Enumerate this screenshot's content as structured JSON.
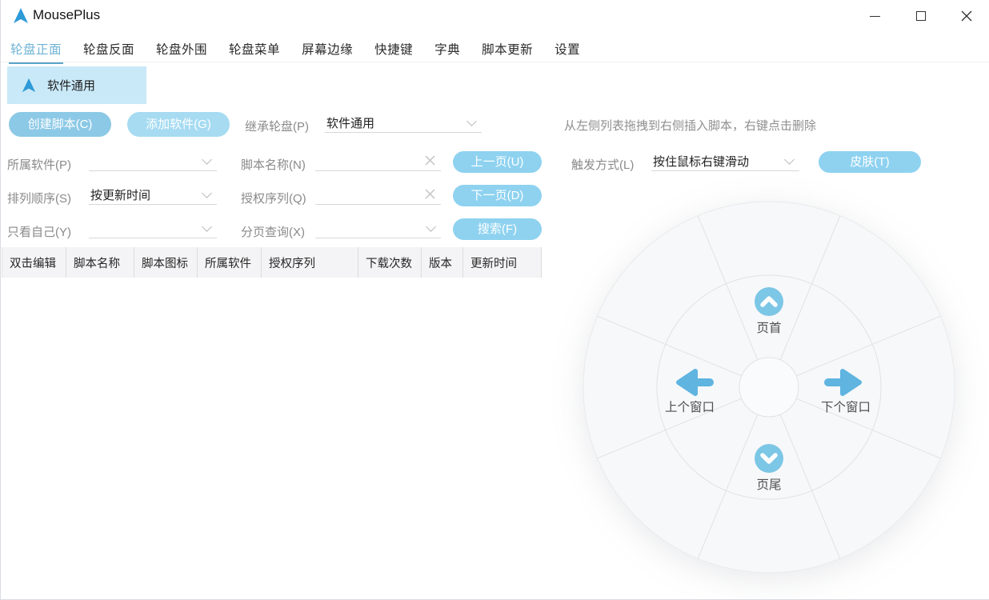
{
  "window": {
    "title": "MousePlus",
    "controls": [
      "minimize",
      "maximize",
      "close"
    ]
  },
  "tabs": [
    {
      "label": "轮盘正面",
      "active": true
    },
    {
      "label": "轮盘反面",
      "active": false
    },
    {
      "label": "轮盘外围",
      "active": false
    },
    {
      "label": "轮盘菜单",
      "active": false
    },
    {
      "label": "屏幕边缘",
      "active": false
    },
    {
      "label": "快捷键",
      "active": false
    },
    {
      "label": "字典",
      "active": false
    },
    {
      "label": "脚本更新",
      "active": false
    },
    {
      "label": "设置",
      "active": false
    }
  ],
  "selected_wheel": {
    "label": "软件通用"
  },
  "toolbar": {
    "create_button": "创建脚本(C)",
    "add_button": "添加软件(G)",
    "inherit_label": "继承轮盘(P)",
    "inherit_value": "软件通用",
    "hint": "从左侧列表拖拽到右侧插入脚本，右键点击删除"
  },
  "filters": {
    "rows": [
      {
        "label": "所属软件(P)",
        "value": "",
        "label2": "脚本名称(N)",
        "value2": "",
        "action": "上一页(U)"
      },
      {
        "label": "排列顺序(S)",
        "value": "按更新时间",
        "label2": "授权序列(Q)",
        "value2": "",
        "action": "下一页(D)"
      },
      {
        "label": "只看自己(Y)",
        "value": "",
        "label2": "分页查询(X)",
        "value2": "",
        "action": "搜索(F)"
      }
    ],
    "trigger_label": "触发方式(L)",
    "trigger_value": "按住鼠标右键滑动",
    "skin_button": "皮肤(T)"
  },
  "table": {
    "headers": [
      "双击编辑",
      "脚本名称",
      "脚本图标",
      "所属软件",
      "授权序列",
      "下载次数",
      "版本",
      "更新时间"
    ],
    "rows": []
  },
  "wheel": {
    "items": [
      {
        "position": "top",
        "icon": "chevron-up-circle-icon",
        "label": "页首"
      },
      {
        "position": "right",
        "icon": "arrow-right-icon",
        "label": "下个窗口"
      },
      {
        "position": "bottom",
        "icon": "chevron-down-circle-icon",
        "label": "页尾"
      },
      {
        "position": "left",
        "icon": "arrow-left-icon",
        "label": "上个窗口"
      }
    ]
  },
  "colors": {
    "accent": "#2f9ad8",
    "active_tab": "#6fb3d4",
    "selected_bg": "#c9e9f8",
    "button_primary": "#8cc9e6",
    "button_secondary": "#a6dbf2",
    "button_action": "#8ed2f0",
    "wheel_icon_circle": "#7cc6e6",
    "wheel_arrow": "#5fb4e0"
  }
}
